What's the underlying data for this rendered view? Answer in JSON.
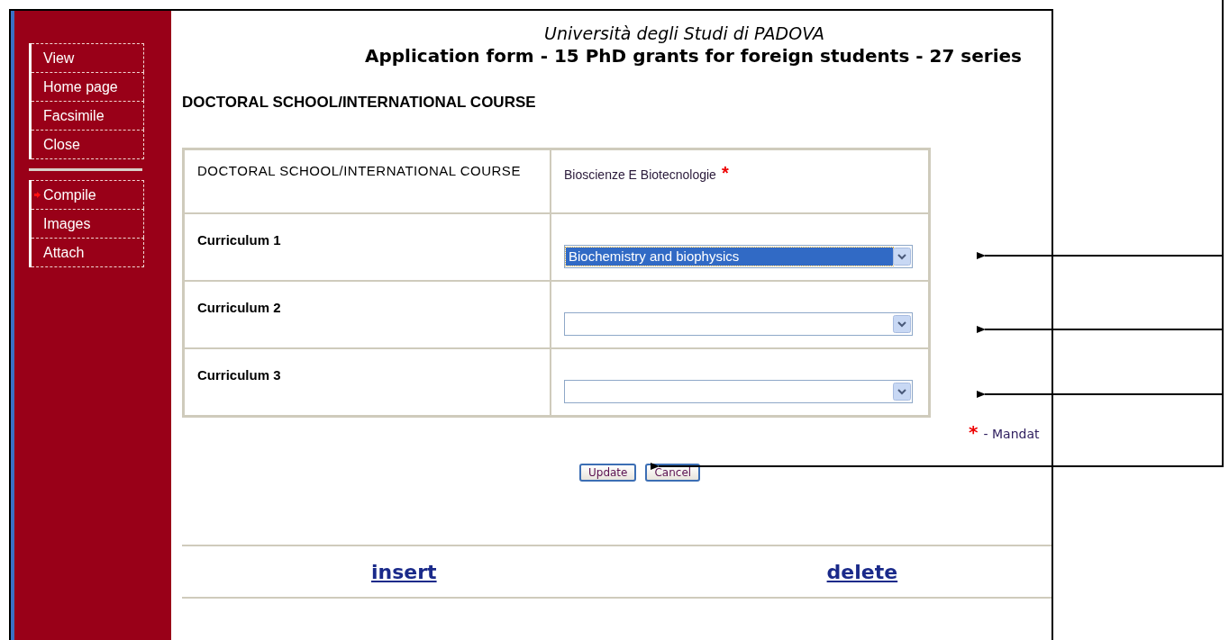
{
  "sidebar": {
    "groups": [
      {
        "items": [
          {
            "label": "View",
            "selected": false
          },
          {
            "label": "Home page",
            "selected": false
          },
          {
            "label": "Facsimile",
            "selected": false
          },
          {
            "label": "Close",
            "selected": false
          }
        ]
      },
      {
        "items": [
          {
            "label": "Compile",
            "selected": true
          },
          {
            "label": "Images",
            "selected": false
          },
          {
            "label": "Attach",
            "selected": false
          }
        ]
      }
    ]
  },
  "header": {
    "university": "Università degli Studi di PADOVA",
    "title": "Application form - 15 PhD grants for foreign students - 27 series"
  },
  "section_heading": "DOCTORAL SCHOOL/INTERNATIONAL COURSE",
  "form": {
    "rows": [
      {
        "kind": "text",
        "label": "DOCTORAL SCHOOL/INTERNATIONAL COURSE",
        "value": "Bioscienze E Biotecnologie",
        "marker": "*"
      },
      {
        "kind": "select",
        "label": "Curriculum 1",
        "value": "Biochemistry and biophysics",
        "highlighted": true
      },
      {
        "kind": "select",
        "label": "Curriculum 2",
        "highlighted": false
      },
      {
        "kind": "select",
        "label": "Curriculum 3",
        "highlighted": false
      }
    ]
  },
  "mandatory_note": {
    "marker": "*",
    "text": "- Mandat"
  },
  "buttons": [
    "Update",
    "Cancel"
  ],
  "links": [
    "insert",
    "delete"
  ]
}
